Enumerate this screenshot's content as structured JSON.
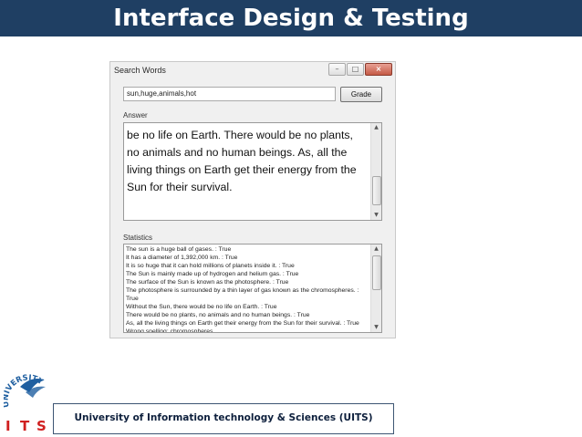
{
  "slide": {
    "title": "Interface Design & Testing",
    "footer": "University of Information technology & Sciences (UITS)",
    "colors": {
      "title_bar": "#1f3f63",
      "footer_border": "#3d5573"
    }
  },
  "logo": {
    "arc_text": "UNIVERSITY",
    "letters": [
      "I",
      "T",
      "S"
    ],
    "colors": {
      "red": "#d02020",
      "blue": "#1f5fa0"
    }
  },
  "window": {
    "title": "Search Words",
    "controls": {
      "minimize": "–",
      "maximize": "□",
      "close": "×"
    },
    "search": {
      "value": "sun,huge,animals,hot"
    },
    "grade_label": "Grade",
    "answer_label": "Answer",
    "answer_text": "be no life on Earth. There would be no plants, no animals and no human beings. As, all the living things on Earth get their energy from the Sun for their survival.",
    "statistics_label": "Statistics",
    "statistics": [
      "The sun is a huge ball of gases. : True",
      "It has a diameter of 1,392,000 km. : True",
      "It is so huge that it can hold millions of planets inside it. : True",
      "The Sun is mainly made up of hydrogen and helium gas. : True",
      "The surface of the Sun is known as the photosphere. : True",
      "The photosphere is surrounded by a thin layer of gas known as the chromospheres. :",
      "True",
      "Without the Sun, there would be no life on Earth. : True",
      "There would be no plants, no animals and no human beings. : True",
      "As, all the living things on Earth get their energy from the Sun for their survival. : True",
      "Wrong spelling: chromospheres."
    ],
    "scroll": {
      "up": "▲",
      "down": "▼"
    }
  }
}
